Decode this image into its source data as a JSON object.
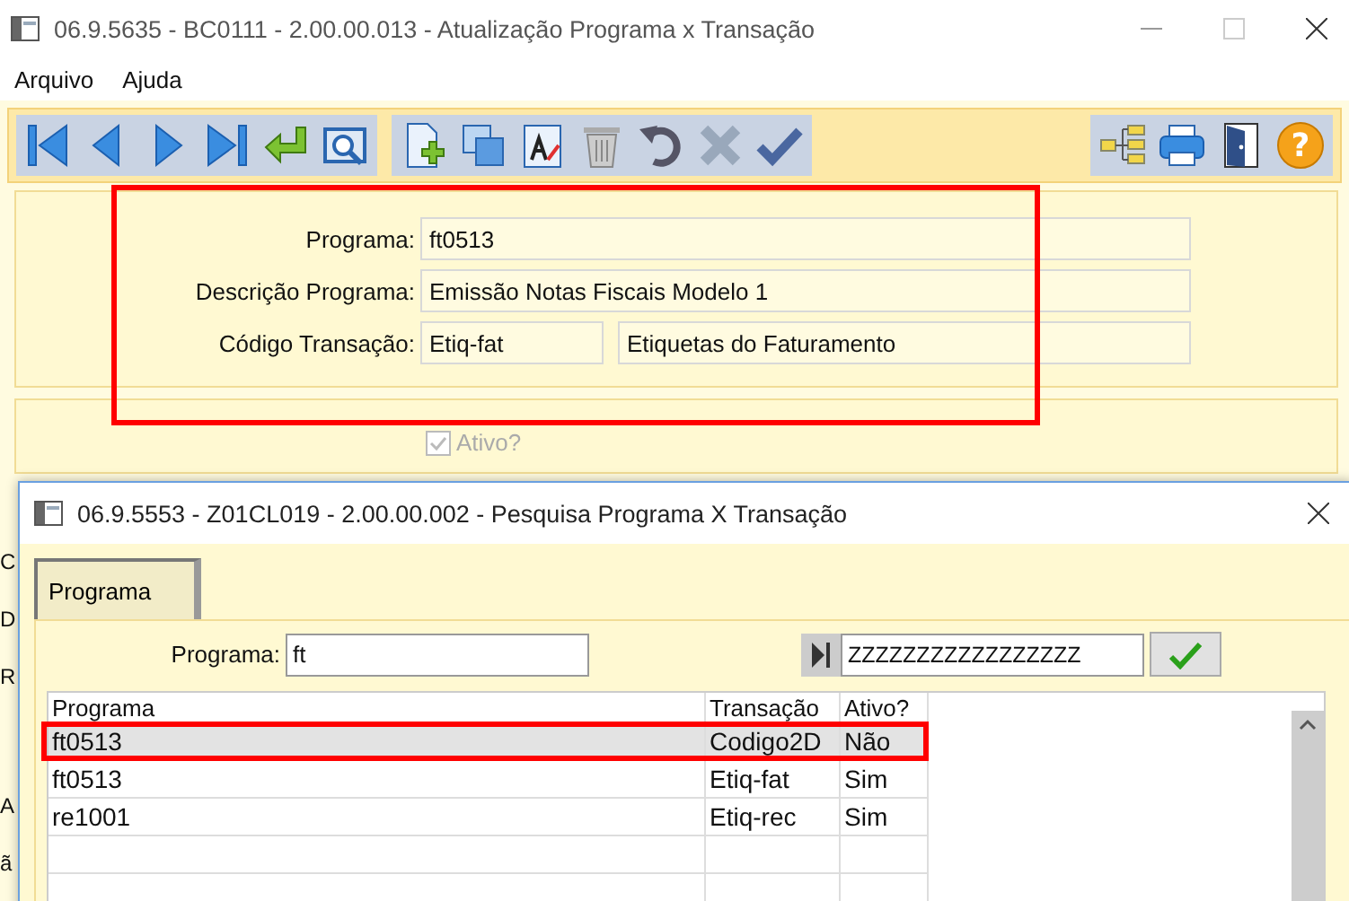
{
  "window": {
    "title": "06.9.5635 - BC0111 - 2.00.00.013 - Atualização Programa x Transação"
  },
  "menu": [
    "Arquivo",
    "Ajuda"
  ],
  "toolbar": {
    "help_glyph": "?"
  },
  "form": {
    "fields": [
      {
        "label": "Programa:",
        "values": [
          "ft0513"
        ]
      },
      {
        "label": "Descrição Programa:",
        "values": [
          "Emissão Notas Fiscais Modelo 1"
        ]
      },
      {
        "label": "Código Transação:",
        "values": [
          "Etiq-fat",
          "Etiquetas do Faturamento"
        ]
      }
    ],
    "active_checkbox": {
      "label": "Ativo?",
      "checked": true,
      "disabled": true
    }
  },
  "background_fragments": [
    "C",
    "D",
    "R",
    "A",
    "ã"
  ],
  "dialog": {
    "title": "06.9.5553 - Z01CL019 - 2.00.00.002 - Pesquisa Programa X Transação",
    "tabs": [
      {
        "label": "Programa",
        "selected": true
      }
    ],
    "search": {
      "label": "Programa:",
      "value": "ft",
      "range_end": "ZZZZZZZZZZZZZZZZZ"
    },
    "table": {
      "columns": [
        "Programa",
        "Transação",
        "Ativo?"
      ],
      "rows": [
        {
          "cells": [
            "ft0513",
            "Codigo2D",
            "Não"
          ],
          "selected": true
        },
        {
          "cells": [
            "ft0513",
            "Etiq-fat",
            "Sim"
          ],
          "selected": false
        },
        {
          "cells": [
            "re1001",
            "Etiq-rec",
            "Sim"
          ],
          "selected": false
        }
      ]
    }
  }
}
